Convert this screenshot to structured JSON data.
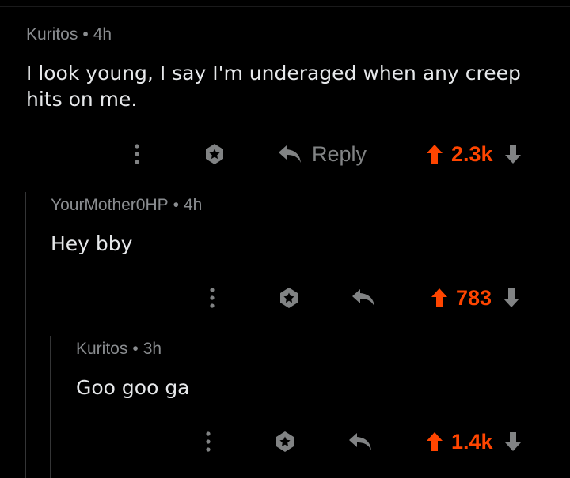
{
  "colors": {
    "background": "#000000",
    "meta": "#8a8d90",
    "text": "#e6e8ea",
    "icon": "#818384",
    "upvote": "#ff4500",
    "thread_line": "#343536"
  },
  "comments": [
    {
      "author": "Kuritos",
      "separator": "•",
      "time": "4h",
      "text": "I look young, I say I'm underaged when any creep hits on me.",
      "reply_label": "Reply",
      "score": "2.3k",
      "icons": [
        "more-vertical-icon",
        "award-icon",
        "reply-arrow-icon",
        "upvote-arrow-icon",
        "downvote-arrow-icon"
      ]
    },
    {
      "author": "YourMother0HP",
      "separator": "•",
      "time": "4h",
      "text": "Hey bby",
      "score": "783",
      "icons": [
        "more-vertical-icon",
        "award-icon",
        "reply-arrow-icon",
        "upvote-arrow-icon",
        "downvote-arrow-icon"
      ]
    },
    {
      "author": "Kuritos",
      "separator": "•",
      "time": "3h",
      "text": "Goo goo ga",
      "score": "1.4k",
      "icons": [
        "more-vertical-icon",
        "award-icon",
        "reply-arrow-icon",
        "upvote-arrow-icon",
        "downvote-arrow-icon"
      ]
    }
  ]
}
